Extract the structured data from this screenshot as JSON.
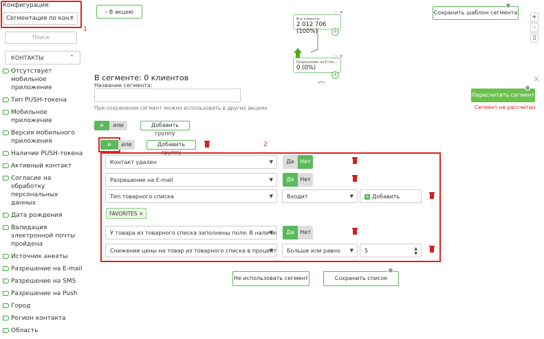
{
  "sidebar": {
    "config_label": "Конфигурация:",
    "config_value": "Сегментация по кон...",
    "marker1": "1",
    "search_placeholder": "Поиск",
    "section_title": "КОНТАКТЫ",
    "items": [
      "Отсутствует мобильное приложение",
      "Тип PUSH-токена",
      "Мобильное приложение",
      "Версия мобильного приложения",
      "Наличие PUSH-токена",
      "Активный контакт",
      "Согласие на обработку персональных данных",
      "Дата рождения",
      "Валидация электронной почты пройдена",
      "Источник анкеты",
      "Разрешение на E-mail",
      "Разрешение на SMS",
      "Разрешение на Push",
      "Город",
      "Регион контакта",
      "Область"
    ]
  },
  "toolbar": {
    "back_label": "В акцию",
    "save_template_label": "Сохранить шаблон сегмента",
    "zoom_in": "+",
    "zoom_out": "-",
    "fit": "▯"
  },
  "flow": {
    "node1_small": "Все клиенты",
    "node1_big": "2 012 706 (100%)",
    "node2_small": "Разрешение на E-ma...",
    "node2_big": "0 (0%)"
  },
  "segment": {
    "title": "В сегменте: 0 клиентов",
    "name_label": "Название сегмента:",
    "name_value": "",
    "hint": "При сохранении сегмент можно использовать в других акциях",
    "recalc_label": "Пересчитать сегмент",
    "not_calc_label": "Сегмент не рассчитан",
    "and_label": "и",
    "or_label": "или",
    "add_group_label": "Добавить группу",
    "marker2": "2"
  },
  "rules": {
    "r1_field": "Контакт удален",
    "r2_field": "Разрешение на E-mail",
    "r3_field": "Тип товарного списка",
    "r3_op": "Входит",
    "r3_add": "Добавить",
    "fav_tag": "FAVORITES ×",
    "r4_field": "У товара из товарного списка заполнены поля: В наличии, Цена,",
    "r5_field": "Снижение цены на товар из товарного списка в процентах",
    "r5_op": "Больше или равно",
    "r5_value": "5",
    "yes": "Да",
    "no": "Нет"
  },
  "bottom": {
    "no_use_label": "Не использовать сегмент",
    "save_list_label": "Сохранить список"
  },
  "colors": {
    "accent": "#5cb85c",
    "alert": "#e02020"
  }
}
